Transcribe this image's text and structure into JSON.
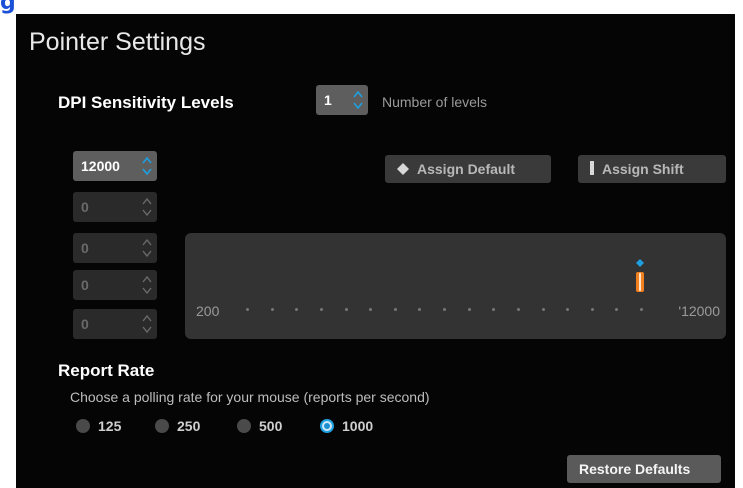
{
  "top_glyph": "g",
  "title": "Pointer Settings",
  "dpi": {
    "title": "DPI Sensitivity Levels",
    "levels_count": "1",
    "levels_label": "Number of levels",
    "levels": [
      "12000",
      "0",
      "0",
      "0",
      "0"
    ],
    "assign_default_label": "Assign Default",
    "assign_shift_label": "Assign Shift",
    "slider": {
      "min_label": "200",
      "max_label": "'12000",
      "min": 200,
      "max": 12000,
      "value": 12000
    }
  },
  "report": {
    "title": "Report Rate",
    "description": "Choose a polling rate for your mouse (reports per second)",
    "options": [
      "125",
      "250",
      "500",
      "1000"
    ],
    "selected": "1000"
  },
  "restore_label": "Restore Defaults",
  "colors": {
    "accent_blue": "#1ea0e0",
    "marker_orange": "#f08020",
    "panel_bg": "#050505"
  }
}
